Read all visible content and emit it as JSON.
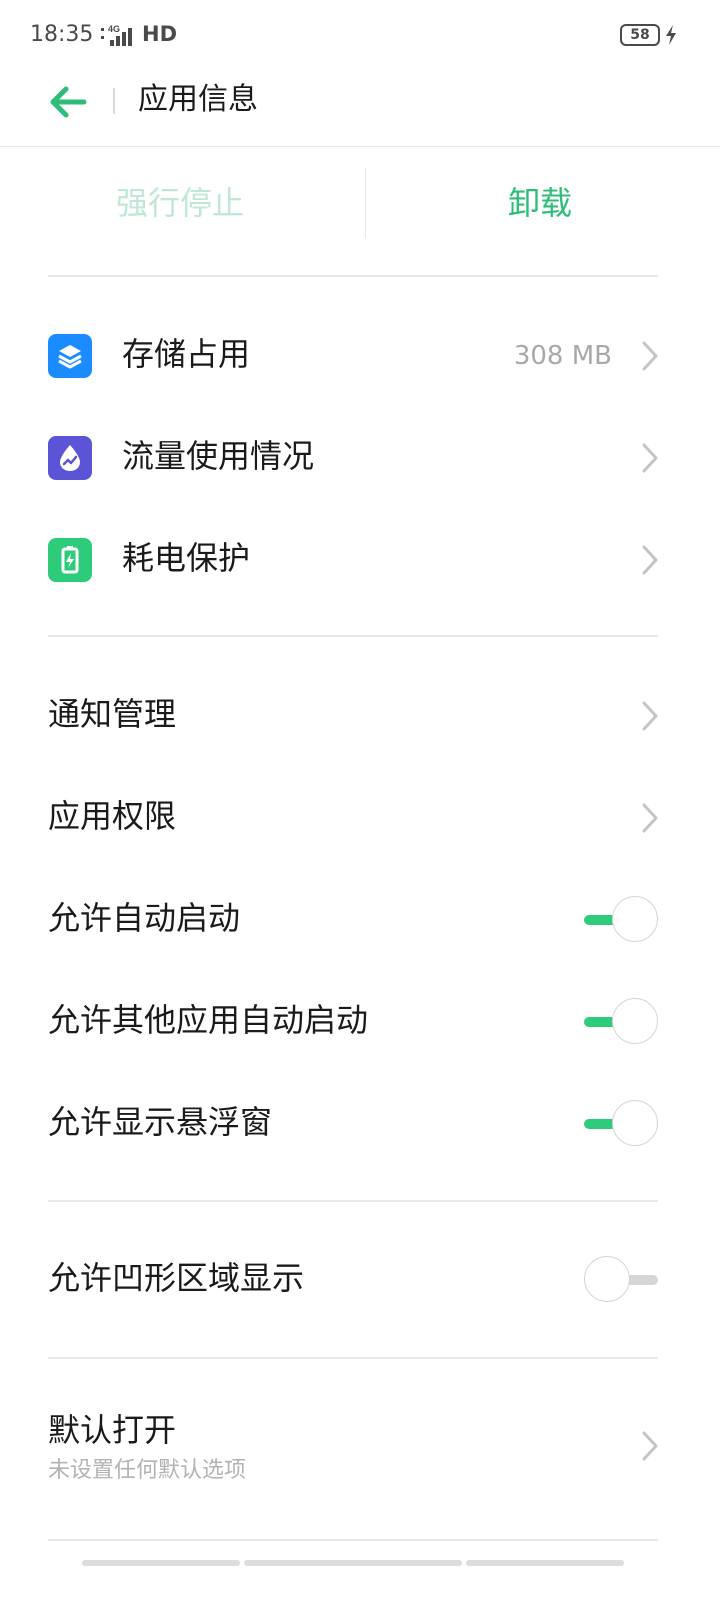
{
  "status_bar": {
    "time": "18:35",
    "network": "HD",
    "network_badge": "4G",
    "battery": "58"
  },
  "header": {
    "title": "应用信息",
    "back_icon": "arrow-left-icon"
  },
  "actions": {
    "force_stop": "强行停止",
    "uninstall": "卸载"
  },
  "app_section": [
    {
      "label": "存储占用",
      "value": "308 MB",
      "icon": "storage-layers-icon",
      "icon_color": "#1a8cff"
    },
    {
      "label": "流量使用情况",
      "value": "",
      "icon": "data-usage-icon",
      "icon_color": "#5b54d6"
    },
    {
      "label": "耗电保护",
      "value": "",
      "icon": "battery-protect-icon",
      "icon_color": "#2ecc7a"
    }
  ],
  "settings_section": [
    {
      "label": "通知管理"
    },
    {
      "label": "应用权限"
    },
    {
      "label": "允许自动启动",
      "toggle": true
    },
    {
      "label": "允许其他应用自动启动",
      "toggle": true
    },
    {
      "label": "允许显示悬浮窗",
      "toggle": true
    }
  ],
  "notch_section": {
    "label": "允许凹形区域显示",
    "toggle": false
  },
  "default_section": {
    "label": "默认打开",
    "sublabel": "未设置任何默认选项"
  },
  "colors": {
    "accent": "#2ebd78",
    "accent_disabled": "#bfe8d4",
    "toggle_on": "#2ecc7a",
    "toggle_off": "#d6d6d6",
    "divider": "#e8e8e8",
    "secondary_text": "#a8a8a8"
  }
}
